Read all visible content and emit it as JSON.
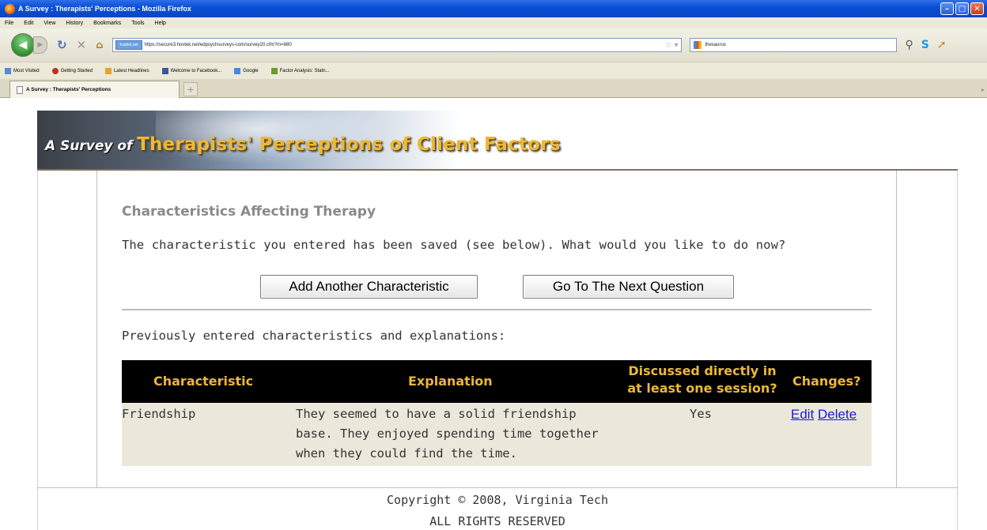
{
  "browser": {
    "window_title": "A Survey : Therapists' Perceptions - Mozilla Firefox",
    "menu": [
      "File",
      "Edit",
      "View",
      "History",
      "Bookmarks",
      "Tools",
      "Help"
    ],
    "site_identity": "hostek.net",
    "url": "https://secure3.hostek.net/edpsychsurveys-com/survey20.cfm?rn=880",
    "search_text": "thesaurus",
    "bookmarks": [
      "Most Visited",
      "Getting Started",
      "Latest Headlines",
      "Welcome to Facebook...",
      "Google",
      "Factor Analysis: Statn..."
    ],
    "tab_title": "A Survey : Therapists' Perceptions",
    "new_tab_symbol": "+"
  },
  "banner": {
    "prefix": "A Survey of",
    "title": "Therapists' Perceptions of Client Factors"
  },
  "content": {
    "heading": "Characteristics Affecting Therapy",
    "saved_message": "The characteristic you entered has been saved (see below). What would you like to do now?",
    "add_button": "Add Another Characteristic",
    "next_button": "Go To The Next Question",
    "previous_label": "Previously entered characteristics and explanations:"
  },
  "table": {
    "headers": {
      "characteristic": "Characteristic",
      "explanation": "Explanation",
      "discussed_line1": "Discussed directly in",
      "discussed_line2": "at least one session?",
      "changes": "Changes?"
    },
    "rows": [
      {
        "characteristic": "Friendship",
        "explanation_lines": [
          "They seemed to have a solid friendship",
          "base. They enjoyed spending time together",
          "when they could find the time."
        ],
        "discussed": "Yes",
        "edit": "Edit",
        "delete": "Delete"
      }
    ]
  },
  "footer": {
    "copyright": "Copyright © 2008, Virginia Tech",
    "rights": "ALL RIGHTS RESERVED"
  },
  "colors": {
    "banner_gold": "#ecb838",
    "header_bg": "#000000",
    "row_bg": "#ebe8db",
    "link": "#1a1ad8"
  }
}
